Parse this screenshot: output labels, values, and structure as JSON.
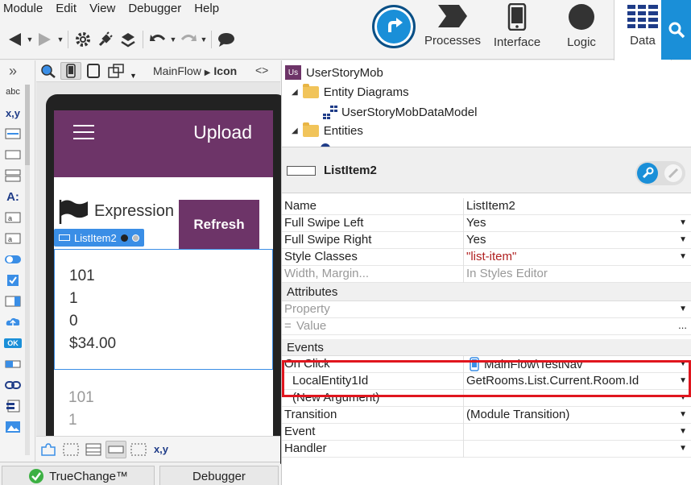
{
  "menu": [
    "Module",
    "Edit",
    "View",
    "Debugger",
    "Help"
  ],
  "nav": [
    {
      "id": "processes",
      "label": "Processes"
    },
    {
      "id": "interface",
      "label": "Interface"
    },
    {
      "id": "logic",
      "label": "Logic"
    },
    {
      "id": "data",
      "label": "Data"
    }
  ],
  "canvas": {
    "breadcrumb_flow": "MainFlow",
    "breadcrumb_screen": "Icon",
    "code_toggle": "<>",
    "app_title": "Upload",
    "expression_label": "Expression",
    "refresh_label": "Refresh",
    "selected_widget": "ListItem2",
    "item1": [
      "101",
      "1",
      "0",
      "$34.00"
    ],
    "item2": [
      "101",
      "1"
    ],
    "bottom_xy": "x,y"
  },
  "palette_labels": {
    "abc": "abc",
    "xy": "x,y",
    "ok": "OK",
    "a": "A:"
  },
  "bottom_tabs": {
    "truechange": "TrueChange™",
    "debugger": "Debugger"
  },
  "tree": {
    "module": "UserStoryMob",
    "module_badge": "Us",
    "entity_diagrams": "Entity Diagrams",
    "diagram": "UserStoryMobDataModel",
    "entities": "Entities"
  },
  "element": {
    "name": "ListItem2"
  },
  "props": {
    "name_k": "Name",
    "name_v": "ListItem2",
    "fsl_k": "Full Swipe Left",
    "fsl_v": "Yes",
    "fsr_k": "Full Swipe Right",
    "fsr_v": "Yes",
    "sc_k": "Style Classes",
    "sc_v": "\"list-item\"",
    "wm_k": "Width, Margin...",
    "wm_v": "In Styles Editor",
    "attributes": "Attributes",
    "prop_k": "Property",
    "eq_k": "=",
    "value_k": "Value",
    "more": "...",
    "events": "Events",
    "onclick_k": "On Click",
    "onclick_v": "MainFlow\\TestNav",
    "arg_k": "LocalEntity1Id",
    "arg_v": "GetRooms.List.Current.Room.Id",
    "newarg_k": "(New Argument)",
    "transition_k": "Transition",
    "transition_v": "(Module Transition)",
    "event_k": "Event",
    "handler_k": "Handler"
  },
  "colors": {
    "accent": "#1a8fd8",
    "app_purple": "#6d3468",
    "highlight": "#e0161e",
    "selection": "#3a8ee6"
  }
}
